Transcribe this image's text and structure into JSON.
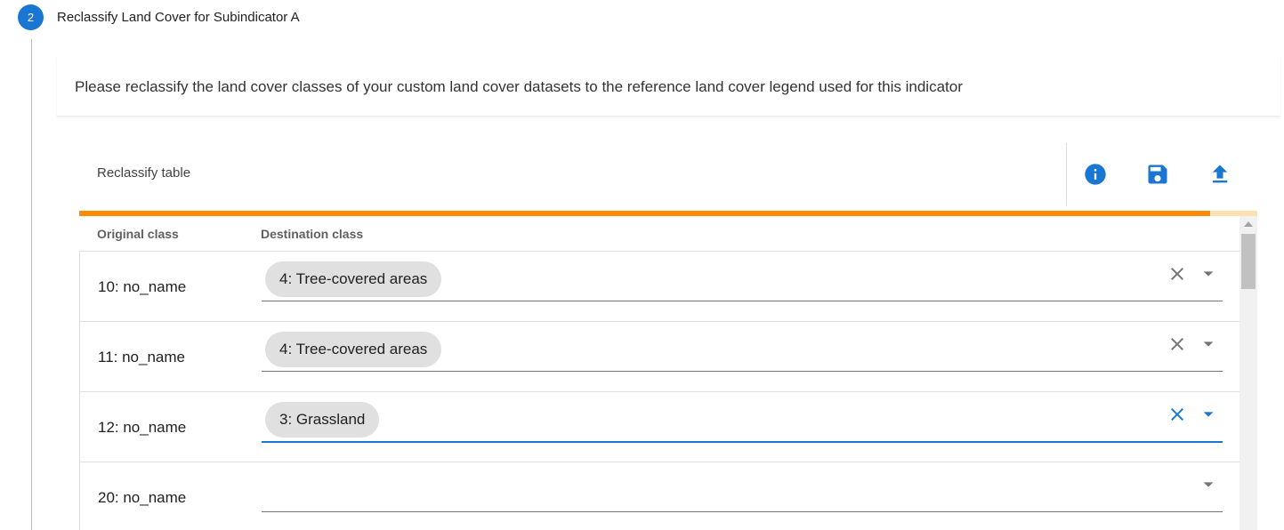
{
  "step": {
    "number": "2",
    "title": "Reclassify Land Cover for Subindicator A"
  },
  "instructions": "Please reclassify the land cover classes of your custom land cover datasets to the reference land cover legend used for this indicator",
  "toolbar": {
    "title": "Reclassify table",
    "icons": [
      "info-icon",
      "save-icon",
      "upload-icon"
    ]
  },
  "progress": {
    "percent": 96
  },
  "table": {
    "columns": [
      "Original class",
      "Destination class"
    ],
    "rows": [
      {
        "original": "10: no_name",
        "destination": "4: Tree-covered areas",
        "focused": false
      },
      {
        "original": "11: no_name",
        "destination": "4: Tree-covered areas",
        "focused": false
      },
      {
        "original": "12: no_name",
        "destination": "3: Grassland",
        "focused": true
      },
      {
        "original": "20: no_name",
        "destination": "",
        "focused": false
      }
    ]
  },
  "colors": {
    "primary": "#1976d2",
    "progress": "#fb8c00",
    "progress_track": "#ffe0b2",
    "chip": "#e0e0e0",
    "icon_grey": "#757575"
  }
}
